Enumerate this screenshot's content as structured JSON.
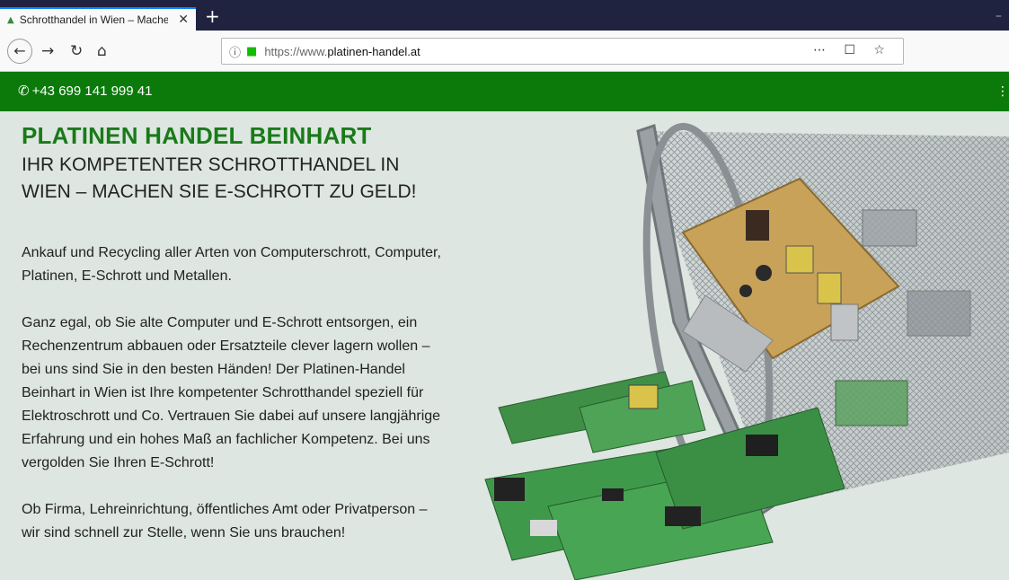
{
  "browser": {
    "tab_title": "Schrotthandel in Wien – Mache",
    "tab_close": "✕",
    "new_tab": "+",
    "minimize": "–",
    "url_prefix": "https://www.",
    "url_domain": "platinen-handel.at",
    "url_actions": "⋯ ☐ ☆"
  },
  "header": {
    "phone": "+43 699 141 999 41",
    "menu_glyph": "⋮"
  },
  "main": {
    "title": "PLATINEN HANDEL BEINHART",
    "subtitle": "IHR KOMPETENTER SCHROTTHANDEL IN WIEN – MACHEN SIE E-SCHROTT ZU GELD!",
    "paragraphs": [
      "Ankauf und Recycling aller Arten von Computerschrott, Computer, Platinen, E-Schrott und Metallen.",
      "Ganz egal, ob Sie alte Computer und E-Schrott entsorgen, ein Rechenzentrum abbauen oder Ersatzteile clever lagern wollen – bei uns sind Sie in den besten Händen! Der Platinen-Handel Beinhart in Wien ist Ihre kompetenter Schrotthandel speziell für Elektroschrott und Co. Vertrauen Sie dabei auf unsere langjährige Erfahrung und ein hohes Maß an fachlicher Kompetenz. Bei uns vergolden Sie Ihren E-Schrott!",
      "Ob Firma, Lehreinrichtung, öffentliches Amt oder Privatperson – wir sind schnell zur Stelle, wenn Sie uns brauchen!"
    ]
  },
  "colors": {
    "brand_green": "#0b7a0b",
    "title_green": "#1a7a1a",
    "page_bg": "#dde6e0"
  }
}
